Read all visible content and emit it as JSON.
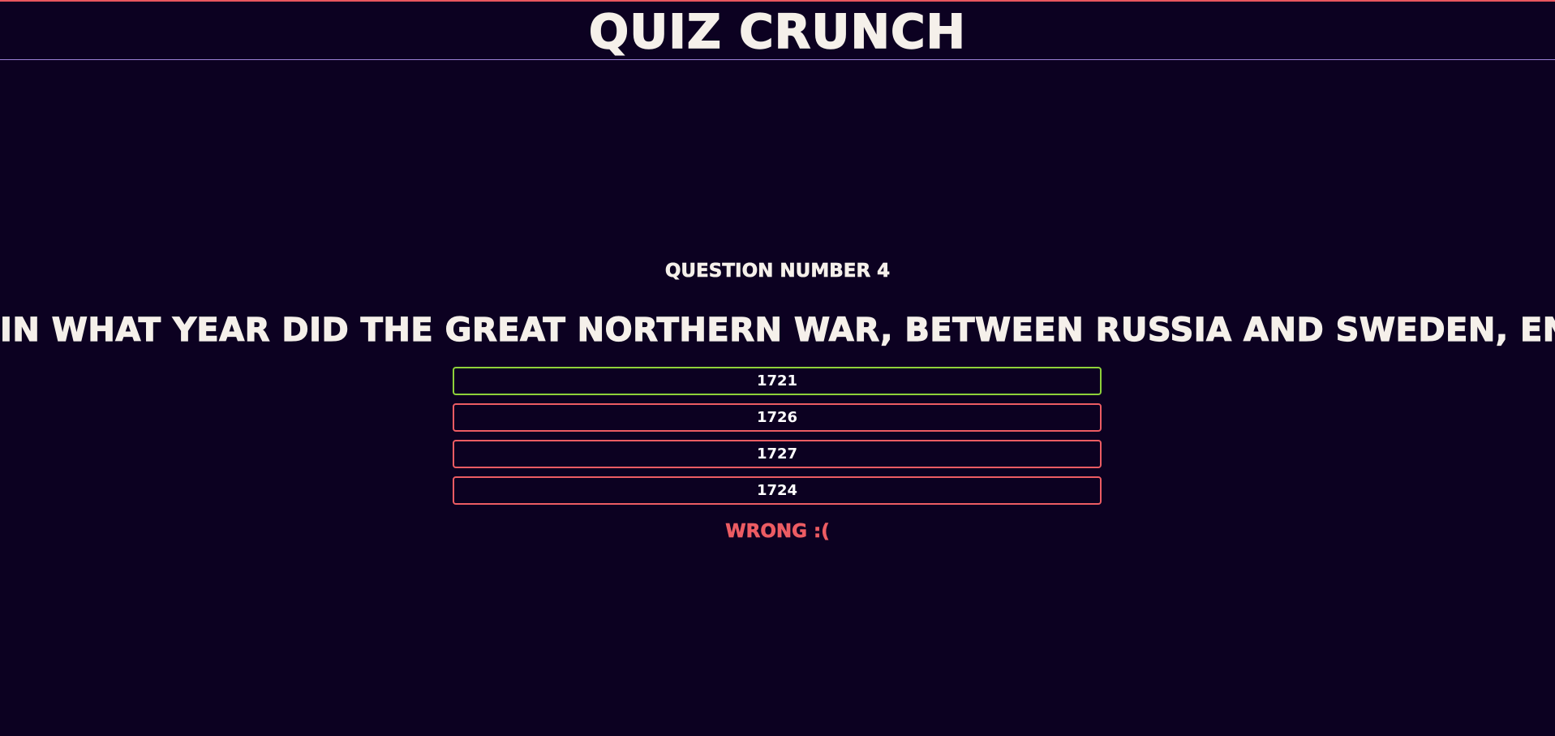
{
  "app": {
    "title": "QUIZ CRUNCH"
  },
  "quiz": {
    "question_number_label": "QUESTION NUMBER 4",
    "question": "IN WHAT YEAR DID THE GREAT NORTHERN WAR, BETWEEN RUSSIA AND SWEDEN, END?",
    "answers": [
      {
        "label": "1721",
        "state": "correct"
      },
      {
        "label": "1726",
        "state": "incorrect"
      },
      {
        "label": "1727",
        "state": "incorrect"
      },
      {
        "label": "1724",
        "state": "incorrect"
      }
    ],
    "result": "WRONG :("
  },
  "colors": {
    "background": "#0c0121",
    "text": "#f5f0ea",
    "correct": "#8ed13a",
    "wrong": "#ec5c63",
    "header_top_border": "#e8565e",
    "header_bottom_border": "#9b7fd6"
  }
}
